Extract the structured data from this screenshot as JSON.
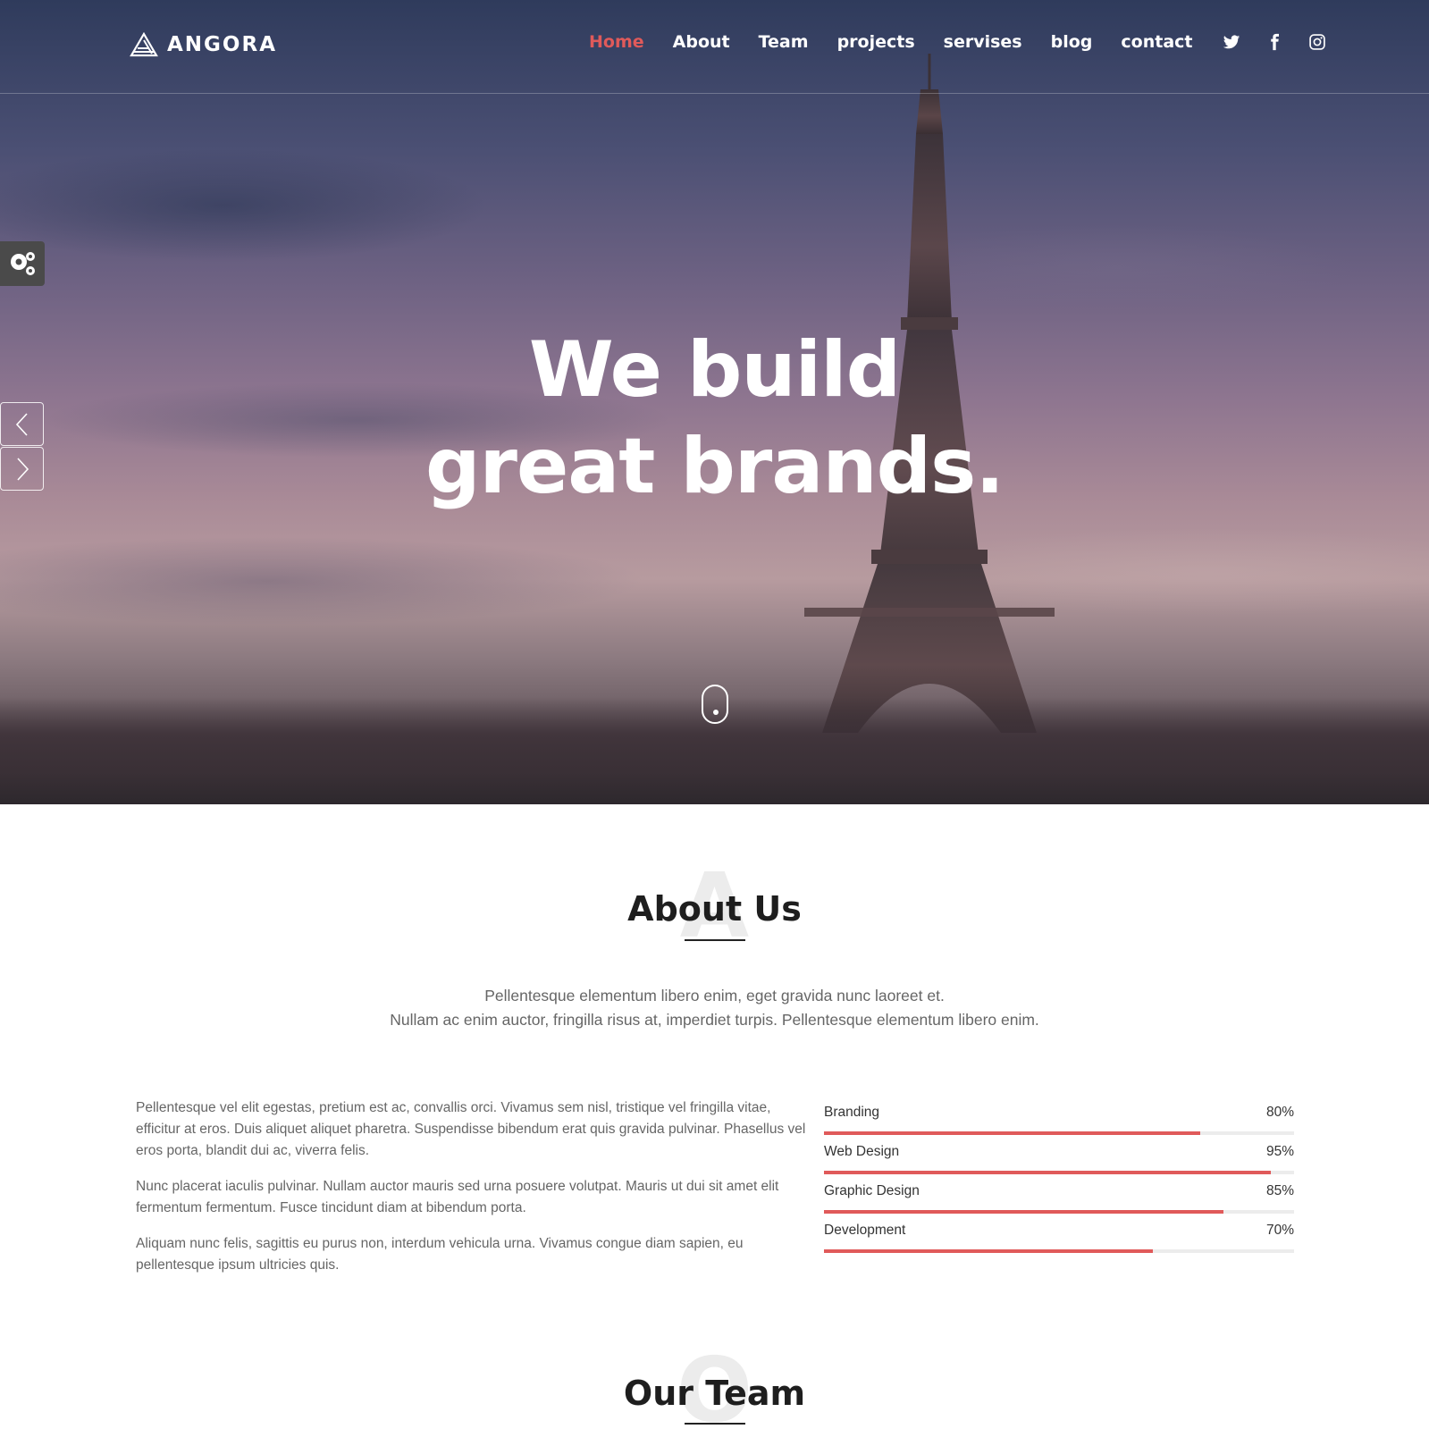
{
  "brand": {
    "name": "ANGORA"
  },
  "nav": {
    "items": [
      {
        "label": "Home",
        "active": true
      },
      {
        "label": "About",
        "active": false
      },
      {
        "label": "Team",
        "active": false
      },
      {
        "label": "projects",
        "active": false
      },
      {
        "label": "servises",
        "active": false
      },
      {
        "label": "blog",
        "active": false
      },
      {
        "label": "contact",
        "active": false
      }
    ],
    "social": [
      "twitter-icon",
      "facebook-icon",
      "instagram-icon"
    ]
  },
  "hero": {
    "title_line1": "We build",
    "title_line2": "great brands."
  },
  "about": {
    "watermark": "A",
    "title": "About Us",
    "lead_line1": "Pellentesque elementum libero enim, eget gravida nunc laoreet et.",
    "lead_line2": "Nullam ac enim auctor, fringilla risus at, imperdiet turpis. Pellentesque elementum libero enim.",
    "paragraphs": [
      "Pellentesque vel elit egestas, pretium est ac, convallis orci. Vivamus sem nisl, tristique vel fringilla vitae, efficitur at eros. Duis aliquet aliquet pharetra. Suspendisse bibendum erat quis gravida pulvinar. Phasellus vel eros porta, blandit dui ac, viverra felis.",
      "Nunc placerat iaculis pulvinar. Nullam auctor mauris sed urna posuere volutpat. Mauris ut dui sit amet elit fermentum fermentum. Fusce tincidunt diam at bibendum porta.",
      "Aliquam nunc felis, sagittis eu purus non, interdum vehicula urna. Vivamus congue diam sapien, eu pellentesque ipsum ultricies quis."
    ],
    "skills": [
      {
        "label": "Branding",
        "value": "80%",
        "percent": 80
      },
      {
        "label": "Web Design",
        "value": "95%",
        "percent": 95
      },
      {
        "label": "Graphic Design",
        "value": "85%",
        "percent": 85
      },
      {
        "label": "Development",
        "value": "70%",
        "percent": 70
      }
    ]
  },
  "team": {
    "watermark": "O",
    "title": "Our Team"
  },
  "colors": {
    "accent": "#e05a5a",
    "heading": "#1e1e1e",
    "body_text": "#666666"
  }
}
